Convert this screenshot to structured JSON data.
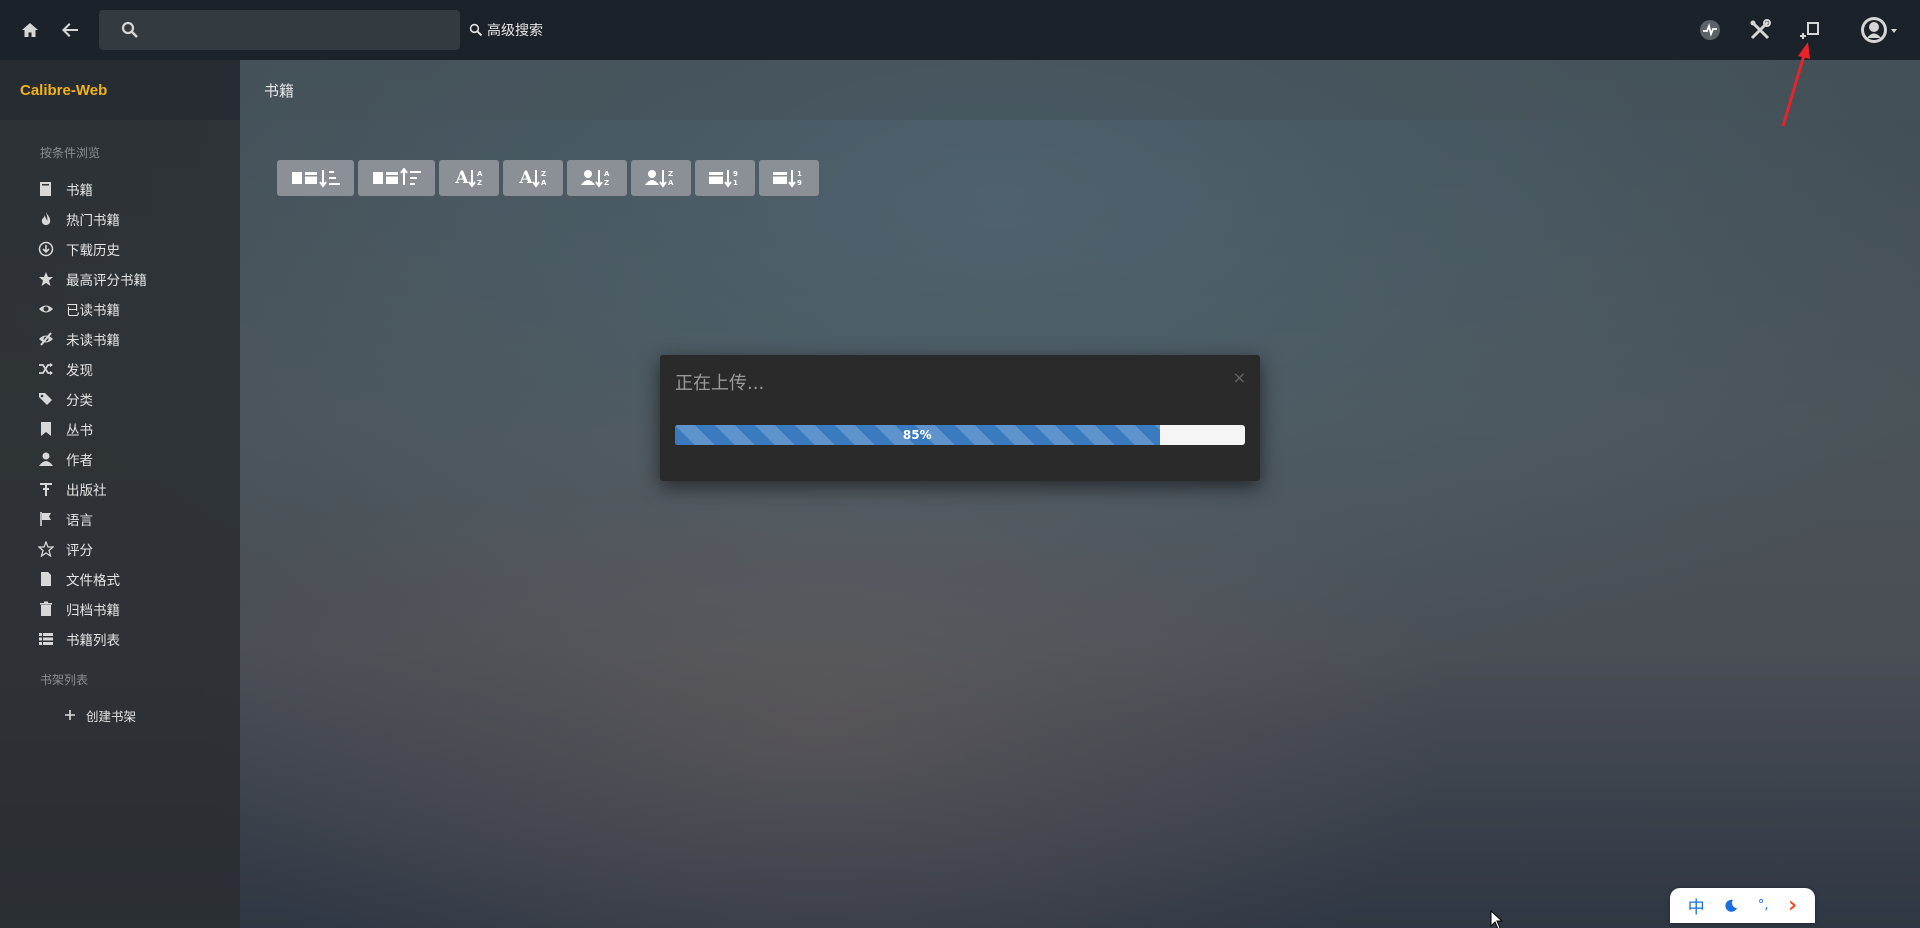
{
  "navbar": {
    "search_placeholder": "",
    "advanced_search_label": "高级搜索",
    "icons": [
      "home-icon",
      "back-icon",
      "search-icon",
      "activity-icon",
      "admin-tools-icon",
      "upload-book-icon",
      "user-avatar-icon"
    ]
  },
  "brand": {
    "name": "Calibre-Web"
  },
  "page": {
    "title": "书籍"
  },
  "sidebar": {
    "browse_heading": "按条件浏览",
    "items": [
      {
        "label": "书籍",
        "icon": "book-icon"
      },
      {
        "label": "热门书籍",
        "icon": "fire-icon"
      },
      {
        "label": "下载历史",
        "icon": "download-icon"
      },
      {
        "label": "最高评分书籍",
        "icon": "star-icon"
      },
      {
        "label": "已读书籍",
        "icon": "eye-icon"
      },
      {
        "label": "未读书籍",
        "icon": "eye-slash-icon"
      },
      {
        "label": "发现",
        "icon": "random-icon"
      },
      {
        "label": "分类",
        "icon": "tags-icon"
      },
      {
        "label": "丛书",
        "icon": "bookmark-icon"
      },
      {
        "label": "作者",
        "icon": "user-icon"
      },
      {
        "label": "出版社",
        "icon": "publisher-icon"
      },
      {
        "label": "语言",
        "icon": "flag-icon"
      },
      {
        "label": "评分",
        "icon": "star-outline-icon"
      },
      {
        "label": "文件格式",
        "icon": "file-icon"
      },
      {
        "label": "归档书籍",
        "icon": "trash-icon"
      },
      {
        "label": "书籍列表",
        "icon": "list-icon"
      }
    ],
    "shelves_heading": "书架列表",
    "create_shelf_label": "创建书架"
  },
  "sort_buttons": [
    {
      "name": "sort-date-new-button",
      "text": ""
    },
    {
      "name": "sort-date-old-button",
      "text": ""
    },
    {
      "name": "sort-title-asc-button",
      "text": "A"
    },
    {
      "name": "sort-title-desc-button",
      "text": "A"
    },
    {
      "name": "sort-author-asc-button",
      "text": ""
    },
    {
      "name": "sort-author-desc-button",
      "text": ""
    },
    {
      "name": "sort-pubdate-new-button",
      "text": ""
    },
    {
      "name": "sort-pubdate-old-button",
      "text": ""
    }
  ],
  "modal": {
    "title": "正在上传...",
    "close": "×",
    "progress_value": 85,
    "progress_label": "85%"
  },
  "ime": {
    "mode": "中",
    "icons": [
      "moon-icon",
      "punctuation-icon",
      "chevron-right-icon"
    ],
    "punct": "°,",
    "arrow": "›"
  },
  "colors": {
    "brand": "#f2b31a",
    "progress": "#3a7bbf",
    "annotation_arrow": "#e8242a"
  }
}
